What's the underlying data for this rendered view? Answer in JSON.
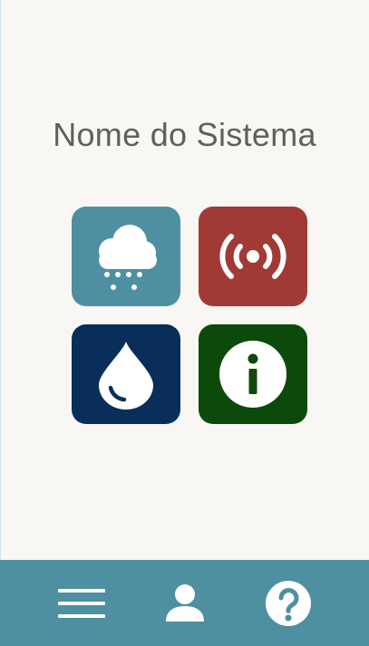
{
  "app": {
    "title": "Nome do Sistema"
  },
  "tiles": [
    {
      "id": "weather",
      "icon": "cloud-snow-icon",
      "color": "#4e8fa2"
    },
    {
      "id": "signal",
      "icon": "broadcast-signal-icon",
      "color": "#a13a35"
    },
    {
      "id": "water",
      "icon": "water-drop-icon",
      "color": "#082e59"
    },
    {
      "id": "info",
      "icon": "info-circle-icon",
      "color": "#0c4a0c"
    }
  ],
  "bottom_bar": {
    "color": "#4e8fa2",
    "items": [
      {
        "id": "menu",
        "icon": "hamburger-menu-icon"
      },
      {
        "id": "user",
        "icon": "user-icon"
      },
      {
        "id": "help",
        "icon": "help-circle-icon"
      }
    ]
  },
  "colors": {
    "background": "#f8f7f4",
    "title_text": "#5f5f5f",
    "icon_fill": "#ffffff"
  }
}
